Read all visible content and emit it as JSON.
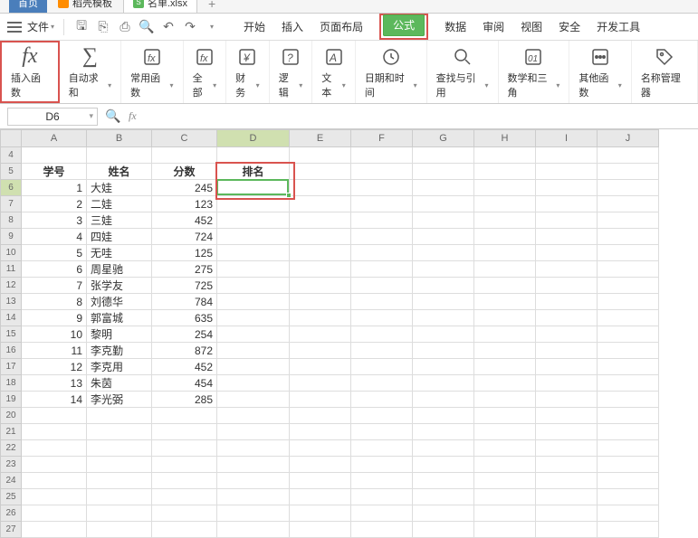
{
  "tabs": {
    "home": "首页",
    "template": "稻壳模板",
    "file": "名单.xlsx"
  },
  "menubar": {
    "file": "文件"
  },
  "menu_tabs": {
    "start": "开始",
    "insert": "插入",
    "layout": "页面布局",
    "formula": "公式",
    "data": "数据",
    "review": "审阅",
    "view": "视图",
    "security": "安全",
    "devtools": "开发工具"
  },
  "ribbon": {
    "insert_fn": "插入函数",
    "autosum": "自动求和",
    "common": "常用函数",
    "all": "全部",
    "finance": "财务",
    "logic": "逻辑",
    "text": "文本",
    "datetime": "日期和时间",
    "lookup": "查找与引用",
    "math": "数学和三角",
    "other": "其他函数",
    "name_mgr": "名称管理器"
  },
  "namebox": "D6",
  "columns": [
    "A",
    "B",
    "C",
    "D",
    "E",
    "F",
    "G",
    "H",
    "I",
    "J"
  ],
  "row_start": 4,
  "row_end": 27,
  "headers": {
    "A": "学号",
    "B": "姓名",
    "C": "分数",
    "D": "排名"
  },
  "rows": [
    {
      "id": 1,
      "name": "大娃",
      "score": 245
    },
    {
      "id": 2,
      "name": "二娃",
      "score": 123
    },
    {
      "id": 3,
      "name": "三娃",
      "score": 452
    },
    {
      "id": 4,
      "name": "四娃",
      "score": 724
    },
    {
      "id": 5,
      "name": "无哇",
      "score": 125
    },
    {
      "id": 6,
      "name": "周星驰",
      "score": 275
    },
    {
      "id": 7,
      "name": "张学友",
      "score": 725
    },
    {
      "id": 8,
      "name": "刘德华",
      "score": 784
    },
    {
      "id": 9,
      "name": "郭富城",
      "score": 635
    },
    {
      "id": 10,
      "name": "黎明",
      "score": 254
    },
    {
      "id": 11,
      "name": "李克勤",
      "score": 872
    },
    {
      "id": 12,
      "name": "李克用",
      "score": 452
    },
    {
      "id": 13,
      "name": "朱茵",
      "score": 454
    },
    {
      "id": 14,
      "name": "李光弼",
      "score": 285
    }
  ],
  "active_cell": "D6"
}
